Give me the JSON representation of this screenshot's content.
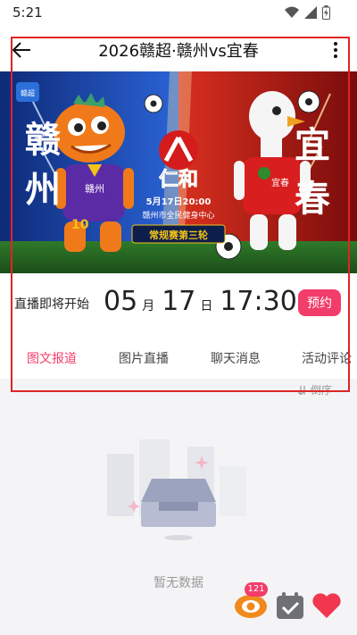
{
  "status_bar": {
    "time": "5:21",
    "icons": [
      "wifi-icon",
      "cell-signal-icon",
      "battery-icon"
    ]
  },
  "header": {
    "title": "2026赣超·赣州vs宜春",
    "back_icon": "back-arrow-icon",
    "more_icon": "more-vertical-icon"
  },
  "banner": {
    "sponsor": "仁和",
    "left_team": "赣州",
    "right_team": "宜春",
    "left_badge": "赣州",
    "right_badge": "宜春",
    "jersey_number": "10",
    "match_time": "5月17日20:00",
    "venue": "赣州市全民健身中心",
    "round": "常规赛第三轮",
    "corner_logo": "赣超"
  },
  "live_info": {
    "status_label": "直播即将开始",
    "month": "05",
    "month_unit": "月",
    "day": "17",
    "day_unit": "日",
    "time": "17:30",
    "reserve_label": "预约"
  },
  "tabs": [
    {
      "label": "图文报道",
      "active": true
    },
    {
      "label": "图片直播",
      "active": false
    },
    {
      "label": "聊天消息",
      "active": false
    },
    {
      "label": "活动评论",
      "active": false
    }
  ],
  "sort": {
    "label": "倒序",
    "icon": "sort-icon"
  },
  "empty_state": {
    "text": "暂无数据"
  },
  "floating": {
    "badge_count": "121"
  },
  "colors": {
    "accent": "#f23d6b",
    "highlight": "#e02424",
    "left_team": "#1d4fb5",
    "right_team": "#c8161d"
  }
}
